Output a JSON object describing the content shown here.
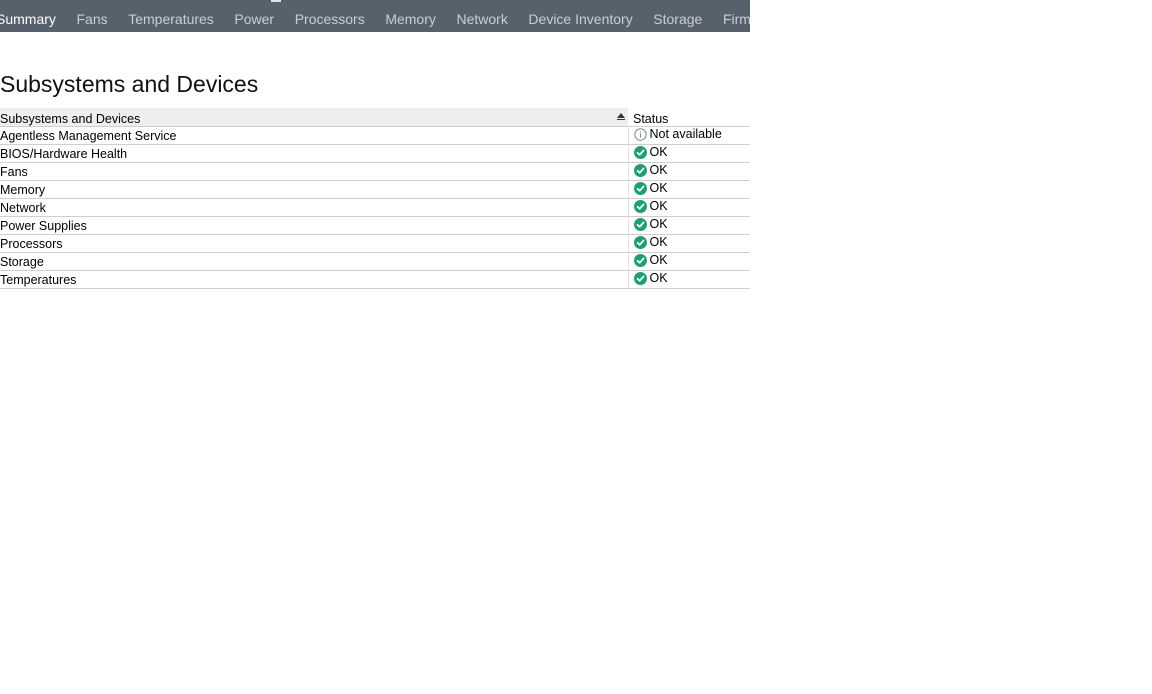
{
  "tabs": [
    {
      "label": "Summary",
      "active": true
    },
    {
      "label": "Fans",
      "active": false
    },
    {
      "label": "Temperatures",
      "active": false
    },
    {
      "label": "Power",
      "active": false
    },
    {
      "label": "Processors",
      "active": false
    },
    {
      "label": "Memory",
      "active": false
    },
    {
      "label": "Network",
      "active": false
    },
    {
      "label": "Device Inventory",
      "active": false
    },
    {
      "label": "Storage",
      "active": false
    },
    {
      "label": "Firmware",
      "active": false
    }
  ],
  "page": {
    "title": "Subsystems and Devices"
  },
  "table": {
    "columns": {
      "name": "Subsystems and Devices",
      "status": "Status",
      "sorted_by": "name",
      "sort_direction": "ascending"
    },
    "rows": [
      {
        "name": "Agentless Management Service",
        "status": "Not available",
        "icon": "info-icon"
      },
      {
        "name": "BIOS/Hardware Health",
        "status": "OK",
        "icon": "ok-check-icon"
      },
      {
        "name": "Fans",
        "status": "OK",
        "icon": "ok-check-icon"
      },
      {
        "name": "Memory",
        "status": "OK",
        "icon": "ok-check-icon"
      },
      {
        "name": "Network",
        "status": "OK",
        "icon": "ok-check-icon"
      },
      {
        "name": "Power Supplies",
        "status": "OK",
        "icon": "ok-check-icon"
      },
      {
        "name": "Processors",
        "status": "OK",
        "icon": "ok-check-icon"
      },
      {
        "name": "Storage",
        "status": "OK",
        "icon": "ok-check-icon"
      },
      {
        "name": "Temperatures",
        "status": "OK",
        "icon": "ok-check-icon"
      }
    ]
  },
  "colors": {
    "tabbar_bg": "#56616b",
    "tab_text": "#c9ced3",
    "tab_active_text": "#ffffff",
    "ok_green": "#1f9e78",
    "info_gray": "#7a8a9a"
  }
}
